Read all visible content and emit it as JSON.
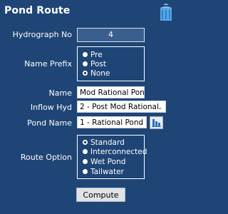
{
  "panel": {
    "title": "Pond Route",
    "logo_icon": "water-tank-icon"
  },
  "hydrograph": {
    "label": "Hydrograph No",
    "value": "4"
  },
  "name_prefix": {
    "label": "Name Prefix",
    "options": [
      "Pre",
      "Post",
      "None"
    ],
    "selected": "None"
  },
  "name": {
    "label": "Name",
    "value": "Mod Rational Pond"
  },
  "inflow_hyd": {
    "label": "Inflow Hyd",
    "value": "2 - Post Mod Rational"
  },
  "pond_name": {
    "label": "Pond Name",
    "value": "1 - Rational Pond",
    "chart_icon": "bar-chart-icon"
  },
  "route_option": {
    "label": "Route Option",
    "options": [
      "Standard",
      "Interconnected",
      "Wet Pond",
      "Tailwater"
    ],
    "selected": "Standard"
  },
  "compute_button": "Compute"
}
